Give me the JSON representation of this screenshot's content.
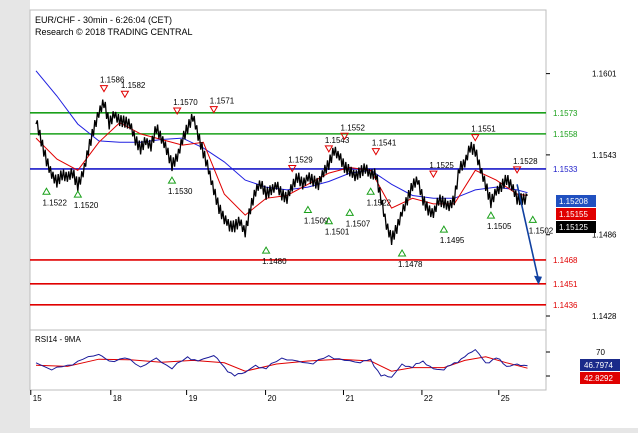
{
  "header": {
    "line1": "EUR/CHF - 30min - 6:26:04 (CET)",
    "line2": "Research © 2018 TRADING CENTRAL"
  },
  "rsi": {
    "label": "RSI14 - 9MA",
    "ticks": [
      70,
      30
    ],
    "current": "46.7974",
    "ma": "42.8292"
  },
  "colors": {
    "price": "#000000",
    "ma_fast": "#e00000",
    "ma_slow": "#2020e0",
    "resistance": "#1aa01a",
    "pivot": "#1a1ac8",
    "support": "#e00000",
    "arrow": "#1040a0"
  },
  "chart_data": {
    "type": "line",
    "instrument": "EUR/CHF",
    "timeframe": "30min",
    "ylim": [
      1.1418,
      1.1625
    ],
    "y_ticks": [
      1.1601,
      1.1543,
      1.1486,
      1.1428
    ],
    "x_day_labels": [
      "15",
      "18",
      "19",
      "20",
      "21",
      "22",
      "25"
    ],
    "price_path": [
      [
        0,
        1.1565
      ],
      [
        1,
        1.1552
      ],
      [
        2,
        1.154
      ],
      [
        3,
        1.1532
      ],
      [
        4,
        1.1525
      ],
      [
        5,
        1.1528
      ],
      [
        6,
        1.1524
      ],
      [
        7,
        1.1529
      ],
      [
        8,
        1.1522
      ],
      [
        9,
        1.1533
      ],
      [
        10,
        1.1548
      ],
      [
        11,
        1.156
      ],
      [
        12,
        1.157
      ],
      [
        13,
        1.1579
      ],
      [
        14,
        1.1566
      ],
      [
        15,
        1.1575
      ],
      [
        16,
        1.1569
      ],
      [
        17,
        1.1566
      ],
      [
        18,
        1.1562
      ],
      [
        19,
        1.1552
      ],
      [
        20,
        1.1548
      ],
      [
        21,
        1.1556
      ],
      [
        22,
        1.1551
      ],
      [
        23,
        1.1562
      ],
      [
        24,
        1.1552
      ],
      [
        25,
        1.1545
      ],
      [
        26,
        1.1536
      ],
      [
        27,
        1.1544
      ],
      [
        28,
        1.1556
      ],
      [
        29,
        1.1562
      ],
      [
        30,
        1.1568
      ],
      [
        31,
        1.1555
      ],
      [
        32,
        1.1545
      ],
      [
        33,
        1.1535
      ],
      [
        34,
        1.152
      ],
      [
        35,
        1.1505
      ],
      [
        36,
        1.1495
      ],
      [
        37,
        1.149
      ],
      [
        38,
        1.1492
      ],
      [
        39,
        1.1498
      ],
      [
        40,
        1.149
      ],
      [
        41,
        1.1505
      ],
      [
        42,
        1.1515
      ],
      [
        43,
        1.152
      ],
      [
        44,
        1.1515
      ],
      [
        45,
        1.152
      ],
      [
        46,
        1.1524
      ],
      [
        47,
        1.1515
      ],
      [
        48,
        1.151
      ],
      [
        49,
        1.1518
      ],
      [
        50,
        1.1527
      ],
      [
        51,
        1.1524
      ],
      [
        52,
        1.153
      ],
      [
        53,
        1.1525
      ],
      [
        54,
        1.152
      ],
      [
        55,
        1.1528
      ],
      [
        56,
        1.1536
      ],
      [
        57,
        1.1548
      ],
      [
        58,
        1.1545
      ],
      [
        59,
        1.1535
      ],
      [
        60,
        1.153
      ],
      [
        61,
        1.1525
      ],
      [
        62,
        1.153
      ],
      [
        63,
        1.1535
      ],
      [
        64,
        1.1532
      ],
      [
        65,
        1.153
      ],
      [
        66,
        1.151
      ],
      [
        67,
        1.149
      ],
      [
        68,
        1.1482
      ],
      [
        69,
        1.1492
      ],
      [
        70,
        1.1505
      ],
      [
        71,
        1.1512
      ],
      [
        72,
        1.152
      ],
      [
        73,
        1.1522
      ],
      [
        74,
        1.151
      ],
      [
        75,
        1.1505
      ],
      [
        76,
        1.1504
      ],
      [
        77,
        1.1512
      ],
      [
        78,
        1.1508
      ],
      [
        79,
        1.1503
      ],
      [
        80,
        1.151
      ],
      [
        81,
        1.1535
      ],
      [
        82,
        1.154
      ],
      [
        83,
        1.155
      ],
      [
        84,
        1.1545
      ],
      [
        85,
        1.153
      ],
      [
        86,
        1.152
      ],
      [
        87,
        1.151
      ],
      [
        88,
        1.152
      ],
      [
        89,
        1.1522
      ],
      [
        90,
        1.1525
      ],
      [
        91,
        1.1518
      ],
      [
        92,
        1.151
      ],
      [
        93,
        1.1512
      ],
      [
        94,
        1.1514
      ]
    ],
    "red_ma_path": [
      [
        0,
        1.1555
      ],
      [
        4,
        1.154
      ],
      [
        8,
        1.1532
      ],
      [
        12,
        1.1552
      ],
      [
        16,
        1.1566
      ],
      [
        20,
        1.1558
      ],
      [
        24,
        1.1554
      ],
      [
        28,
        1.155
      ],
      [
        32,
        1.1552
      ],
      [
        36,
        1.1515
      ],
      [
        40,
        1.15
      ],
      [
        44,
        1.1512
      ],
      [
        48,
        1.1514
      ],
      [
        52,
        1.1522
      ],
      [
        56,
        1.153
      ],
      [
        60,
        1.1534
      ],
      [
        64,
        1.1532
      ],
      [
        68,
        1.1505
      ],
      [
        72,
        1.1512
      ],
      [
        76,
        1.1508
      ],
      [
        80,
        1.1508
      ],
      [
        84,
        1.1532
      ],
      [
        88,
        1.1525
      ],
      [
        92,
        1.1515
      ],
      [
        94,
        1.1514
      ]
    ],
    "blue_ma_path": [
      [
        0,
        1.1603
      ],
      [
        4,
        1.1585
      ],
      [
        8,
        1.1565
      ],
      [
        12,
        1.1553
      ],
      [
        16,
        1.1552
      ],
      [
        20,
        1.1552
      ],
      [
        24,
        1.1554
      ],
      [
        28,
        1.1555
      ],
      [
        32,
        1.1548
      ],
      [
        36,
        1.1538
      ],
      [
        40,
        1.1525
      ],
      [
        44,
        1.152
      ],
      [
        48,
        1.1518
      ],
      [
        52,
        1.152
      ],
      [
        56,
        1.1524
      ],
      [
        60,
        1.153
      ],
      [
        64,
        1.1532
      ],
      [
        68,
        1.1522
      ],
      [
        72,
        1.1514
      ],
      [
        76,
        1.1512
      ],
      [
        80,
        1.1512
      ],
      [
        84,
        1.1518
      ],
      [
        88,
        1.152
      ],
      [
        92,
        1.1518
      ],
      [
        94,
        1.1516
      ]
    ],
    "levels": [
      {
        "value": 1.1573,
        "label": "1.1573",
        "kind": "resistance"
      },
      {
        "value": 1.1558,
        "label": "1.1558",
        "kind": "resistance"
      },
      {
        "value": 1.1533,
        "label": "1.1533",
        "kind": "pivot"
      },
      {
        "value": 1.1468,
        "label": "1.1468",
        "kind": "support"
      },
      {
        "value": 1.1451,
        "label": "1.1451",
        "kind": "support"
      },
      {
        "value": 1.1436,
        "label": "1.1436",
        "kind": "support"
      }
    ],
    "current_price_tags": [
      {
        "label": "1.15208",
        "value": 1.15208,
        "color": "#2050c0"
      },
      {
        "label": "1.15155",
        "value": 1.15155,
        "color": "#e00000"
      },
      {
        "label": "1.15125",
        "value": 1.15125,
        "color": "#000000"
      }
    ],
    "swing_points": [
      {
        "x": 2,
        "value": 1.1522,
        "kind": "low"
      },
      {
        "x": 8,
        "value": 1.152,
        "kind": "low"
      },
      {
        "x": 13,
        "value": 1.1586,
        "kind": "high"
      },
      {
        "x": 17,
        "value": 1.1582,
        "kind": "high"
      },
      {
        "x": 26,
        "value": 1.153,
        "kind": "low"
      },
      {
        "x": 27,
        "value": 1.157,
        "kind": "high"
      },
      {
        "x": 34,
        "value": 1.1571,
        "kind": "high"
      },
      {
        "x": 44,
        "value": 1.148,
        "kind": "low"
      },
      {
        "x": 49,
        "value": 1.1529,
        "kind": "high"
      },
      {
        "x": 52,
        "value": 1.1509,
        "kind": "low"
      },
      {
        "x": 56,
        "value": 1.1543,
        "kind": "high"
      },
      {
        "x": 56,
        "value": 1.1501,
        "kind": "low"
      },
      {
        "x": 59,
        "value": 1.1552,
        "kind": "high"
      },
      {
        "x": 60,
        "value": 1.1507,
        "kind": "low"
      },
      {
        "x": 64,
        "value": 1.1522,
        "kind": "low"
      },
      {
        "x": 65,
        "value": 1.1541,
        "kind": "high"
      },
      {
        "x": 70,
        "value": 1.1478,
        "kind": "low"
      },
      {
        "x": 76,
        "value": 1.1525,
        "kind": "high"
      },
      {
        "x": 78,
        "value": 1.1495,
        "kind": "low"
      },
      {
        "x": 84,
        "value": 1.1551,
        "kind": "high"
      },
      {
        "x": 87,
        "value": 1.1505,
        "kind": "low"
      },
      {
        "x": 92,
        "value": 1.1528,
        "kind": "high"
      },
      {
        "x": 95,
        "value": 1.1502,
        "kind": "low"
      }
    ],
    "forecast_arrow": {
      "from_x": 92,
      "from_value": 1.1522,
      "to_x": 96,
      "to_value": 1.1451
    },
    "rsi14_path": [
      [
        0,
        52
      ],
      [
        3,
        40
      ],
      [
        6,
        48
      ],
      [
        9,
        58
      ],
      [
        12,
        66
      ],
      [
        14,
        55
      ],
      [
        17,
        60
      ],
      [
        20,
        45
      ],
      [
        23,
        60
      ],
      [
        26,
        42
      ],
      [
        29,
        62
      ],
      [
        31,
        55
      ],
      [
        34,
        64
      ],
      [
        36,
        45
      ],
      [
        38,
        30
      ],
      [
        40,
        36
      ],
      [
        42,
        48
      ],
      [
        44,
        42
      ],
      [
        47,
        60
      ],
      [
        50,
        55
      ],
      [
        53,
        50
      ],
      [
        56,
        64
      ],
      [
        59,
        56
      ],
      [
        62,
        52
      ],
      [
        64,
        58
      ],
      [
        66,
        30
      ],
      [
        68,
        28
      ],
      [
        70,
        50
      ],
      [
        72,
        44
      ],
      [
        74,
        55
      ],
      [
        76,
        42
      ],
      [
        78,
        40
      ],
      [
        80,
        52
      ],
      [
        82,
        62
      ],
      [
        84,
        74
      ],
      [
        86,
        52
      ],
      [
        88,
        60
      ],
      [
        90,
        46
      ],
      [
        92,
        50
      ],
      [
        94,
        47
      ]
    ],
    "rsi_ma_path": [
      [
        0,
        48
      ],
      [
        6,
        46
      ],
      [
        12,
        58
      ],
      [
        18,
        57
      ],
      [
        24,
        53
      ],
      [
        30,
        56
      ],
      [
        36,
        52
      ],
      [
        40,
        38
      ],
      [
        46,
        50
      ],
      [
        52,
        55
      ],
      [
        58,
        58
      ],
      [
        64,
        55
      ],
      [
        68,
        38
      ],
      [
        72,
        44
      ],
      [
        78,
        44
      ],
      [
        82,
        56
      ],
      [
        86,
        62
      ],
      [
        90,
        52
      ],
      [
        94,
        43
      ]
    ],
    "rsi_ylim": [
      10,
      90
    ]
  }
}
